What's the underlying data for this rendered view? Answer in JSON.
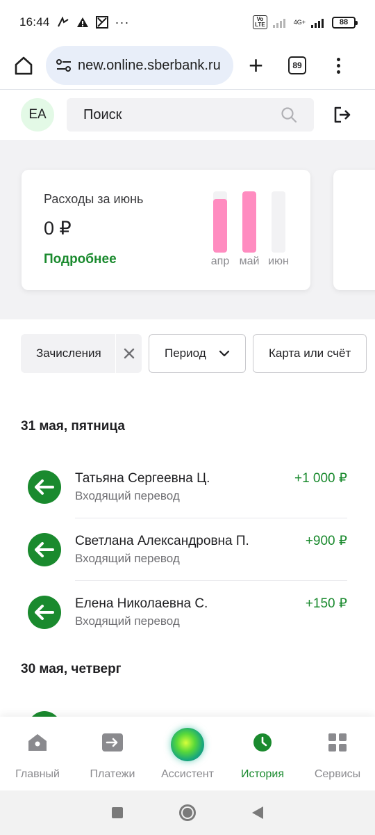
{
  "status_bar": {
    "time": "16:44",
    "dots": "···",
    "network_label": "4G+",
    "battery": "88"
  },
  "browser": {
    "url": "new.online.sberbank.ru",
    "tab_count": "89"
  },
  "header": {
    "avatar_initials": "ЕА",
    "search_placeholder": "Поиск"
  },
  "expense_card": {
    "title": "Расходы за июнь",
    "amount": "0 ₽",
    "link": "Подробнее",
    "bars": [
      {
        "label": "апр",
        "value": 0.88
      },
      {
        "label": "май",
        "value": 1.0
      },
      {
        "label": "июн",
        "value": 0.0
      }
    ]
  },
  "filters": {
    "active": "Зачисления",
    "period": "Период",
    "account": "Карта или счёт"
  },
  "groups": [
    {
      "date": "31 мая, пятница",
      "items": [
        {
          "name": "Татьяна Сергеевна Ц.",
          "type": "Входящий перевод",
          "amount": "+1 000 ₽"
        },
        {
          "name": "Светлана Александровна П.",
          "type": "Входящий перевод",
          "amount": "+900 ₽"
        },
        {
          "name": "Елена Николаевна С.",
          "type": "Входящий перевод",
          "amount": "+150 ₽"
        }
      ]
    },
    {
      "date": "30 мая, четверг",
      "items": []
    }
  ],
  "bottom_nav": [
    {
      "label": "Главный",
      "icon": "home-icon"
    },
    {
      "label": "Платежи",
      "icon": "transfer-icon"
    },
    {
      "label": "Ассистент",
      "icon": "assistant-orb-icon"
    },
    {
      "label": "История",
      "icon": "clock-icon",
      "active": true
    },
    {
      "label": "Сервисы",
      "icon": "grid-icon"
    }
  ],
  "colors": {
    "accent_green": "#1a8a2e",
    "bar_pink": "#ff8cc0",
    "gray_bg": "#f2f2f4"
  }
}
